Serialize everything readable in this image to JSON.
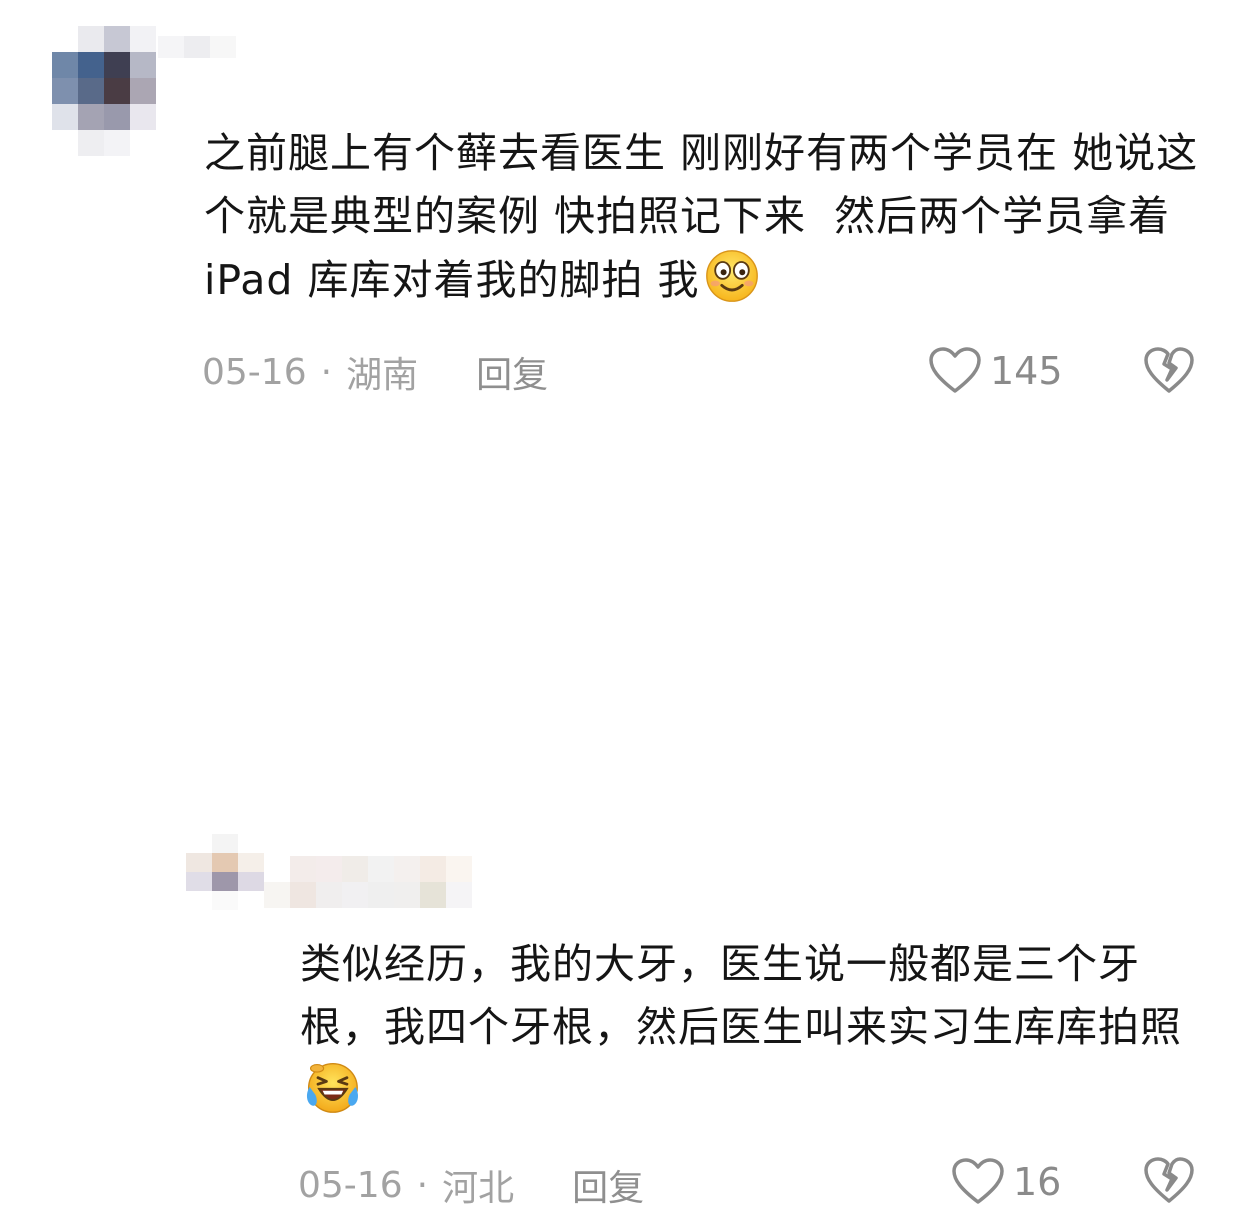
{
  "comments": [
    {
      "text": "之前腿上有个藓去看医生 刚刚好有两个学员在 她说这个就是典型的案例 快拍照记下来  然后两个学员拿着iPad 库库对着我的脚拍 我",
      "emoji": "smile-emoji",
      "date": "05-16",
      "separator": "·",
      "location": "湖南",
      "reply_label": "回复",
      "likes": "145",
      "avatar_colors": [
        "#ffffff",
        "#eaeaee",
        "#c7c8d4",
        "#f2f2f5",
        "#6f87a8",
        "#44628d",
        "#3f3f52",
        "#b6b8c6",
        "#7e90ae",
        "#596a89",
        "#4a3c44",
        "#aba6b3",
        "#dfe2ea",
        "#a4a3b3",
        "#9999ac",
        "#e9e7ee",
        "#ffffff",
        "#eeeef1",
        "#f3f3f6",
        "#ffffff"
      ],
      "name_colors": [
        "#f5f5f7",
        "#ededf0",
        "#f7f7f7",
        "#ffffff",
        "#ffffff",
        "#ffffff",
        "#ffffff",
        "#ffffff",
        "#ffffff",
        "#ffffff"
      ]
    },
    {
      "text": "类似经历，我的大牙，医生说一般都是三个牙根，我四个牙根，然后医生叫来实习生库库拍照",
      "emoji": "laughing-tears-emoji",
      "date": "05-16",
      "separator": "·",
      "location": "河北",
      "reply_label": "回复",
      "likes": "16",
      "avatar_colors": [
        "#ffffff",
        "#f4f4f4",
        "#ffffff",
        "#efe7e1",
        "#e4c9b2",
        "#f5efe9",
        "#e0dde7",
        "#9e97aa",
        "#ddd9e4",
        "#ffffff",
        "#fafafa",
        "#ffffff"
      ],
      "name_colors": [
        "#ffffff",
        "#f3ecea",
        "#f4ecec",
        "#f0ece8",
        "#f2f2f2",
        "#f4f0ee",
        "#f4ebe4",
        "#faf5f0",
        "#ffffff",
        "#f7f5f2",
        "#efe6e1",
        "#f0eeee",
        "#f1f0f2",
        "#efefef",
        "#f0efee",
        "#e6e3d8",
        "#f5f4f6",
        "#ffffff"
      ]
    }
  ]
}
